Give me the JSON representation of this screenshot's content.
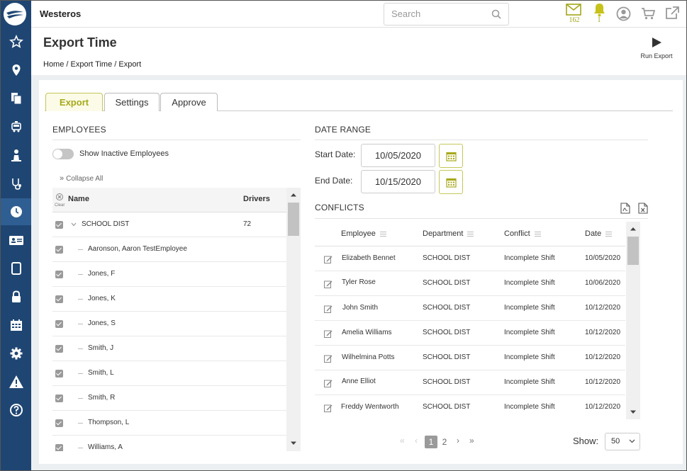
{
  "app": {
    "brand": "Westeros"
  },
  "search": {
    "placeholder": "Search"
  },
  "topbar": {
    "mail_count": "162",
    "bell_count": "1"
  },
  "page": {
    "title": "Export Time",
    "breadcrumb": "Home / Export Time / Export",
    "run_export_label": "Run Export"
  },
  "tabs": [
    {
      "label": "Export",
      "active": true
    },
    {
      "label": "Settings",
      "active": false
    },
    {
      "label": "Approve",
      "active": false
    }
  ],
  "employees": {
    "title": "EMPLOYEES",
    "toggle_label": "Show Inactive Employees",
    "collapse_label": "Collapse All",
    "clear_label": "Clear",
    "col_name": "Name",
    "col_drivers": "Drivers",
    "group": {
      "name": "SCHOOL DIST",
      "drivers": "72"
    },
    "rows": [
      "Aaronson, Aaron TestEmployee",
      "Jones, F",
      "Jones, K",
      "Jones, S",
      "Smith, J",
      "Smith, L",
      "Smith, R",
      "Thompson, L",
      "Williams, A"
    ]
  },
  "date_range": {
    "title": "DATE RANGE",
    "start_label": "Start Date:",
    "start_value": "10/05/2020",
    "end_label": "End Date:",
    "end_value": "10/15/2020"
  },
  "conflicts": {
    "title": "CONFLICTS",
    "columns": [
      "Employee",
      "Department",
      "Conflict",
      "Date"
    ],
    "rows": [
      [
        "Elizabeth Bennet",
        "SCHOOL DIST",
        "Incomplete Shift",
        "10/05/2020"
      ],
      [
        "Tyler Rose",
        "SCHOOL DIST",
        "Incomplete Shift",
        "10/06/2020"
      ],
      [
        "John Smith",
        "SCHOOL DIST",
        "Incomplete Shift",
        "10/12/2020"
      ],
      [
        "Amelia Williams",
        "SCHOOL DIST",
        "Incomplete Shift",
        "10/12/2020"
      ],
      [
        "Wilhelmina Potts",
        "SCHOOL DIST",
        "Incomplete Shift",
        "10/12/2020"
      ],
      [
        "Anne Elliot",
        "SCHOOL DIST",
        "Incomplete Shift",
        "10/12/2020"
      ],
      [
        "Freddy Wentworth",
        "SCHOOL DIST",
        "Incomplete Shift",
        "10/12/2020"
      ]
    ]
  },
  "pagination": {
    "pages": [
      "1",
      "2"
    ],
    "current": "1",
    "show_label": "Show:",
    "show_value": "50"
  },
  "colors": {
    "sidebar": "#1f4673",
    "accent": "#a6a81a",
    "bell": "#c7c21a"
  }
}
